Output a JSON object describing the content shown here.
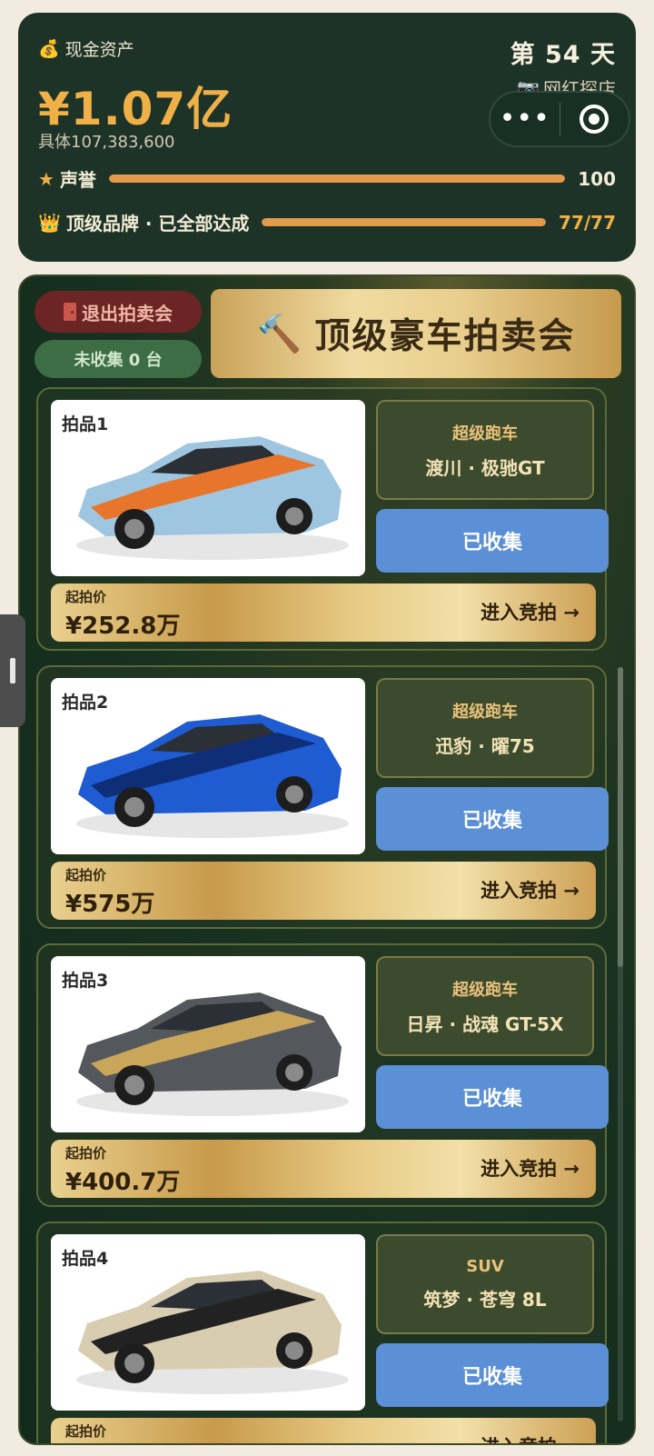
{
  "header": {
    "cash_label": "现金资产",
    "cash_value": "¥1.07亿",
    "cash_detail": "具体107,383,600",
    "day": "第 54 天",
    "role": "网红探店",
    "menu_glyph": "•••",
    "reputation": {
      "label": "声誉",
      "value": "100",
      "progress": 1.0
    },
    "brand": {
      "label": "顶级品牌 · 已全部达成",
      "value": "77/77",
      "progress": 1.0
    }
  },
  "auction": {
    "exit_label": "退出拍卖会",
    "uncollected_label": "未收集 0 台",
    "title": "顶级豪车拍卖会",
    "price_label": "起拍价",
    "enter_label": "进入竞拍 →",
    "collected_label": "已收集",
    "lots": [
      {
        "no": "拍品1",
        "category": "超级跑车",
        "name": "渡川 · 极驰GT",
        "price": "¥252.8万",
        "body_color": "#9fc6e0",
        "accent_color": "#e8752c"
      },
      {
        "no": "拍品2",
        "category": "超级跑车",
        "name": "迅豹 · 曜75",
        "price": "¥575万",
        "body_color": "#1f5cd1",
        "accent_color": "#0e2e78"
      },
      {
        "no": "拍品3",
        "category": "超级跑车",
        "name": "日昇 · 战魂 GT-5X",
        "price": "¥400.7万",
        "body_color": "#54575b",
        "accent_color": "#c9a65a"
      },
      {
        "no": "拍品4",
        "category": "SUV",
        "name": "筑梦 · 苍穹 8L",
        "price": "",
        "body_color": "#d8cdb0",
        "accent_color": "#222222"
      }
    ]
  },
  "colors": {
    "panel_green": "#1e3328",
    "gold_text": "#f0b048",
    "progress_orange": "#e29a4c",
    "collected_blue": "#5b8fd6",
    "exit_red": "#6b2524",
    "uncollected_green": "#3d6d44"
  }
}
